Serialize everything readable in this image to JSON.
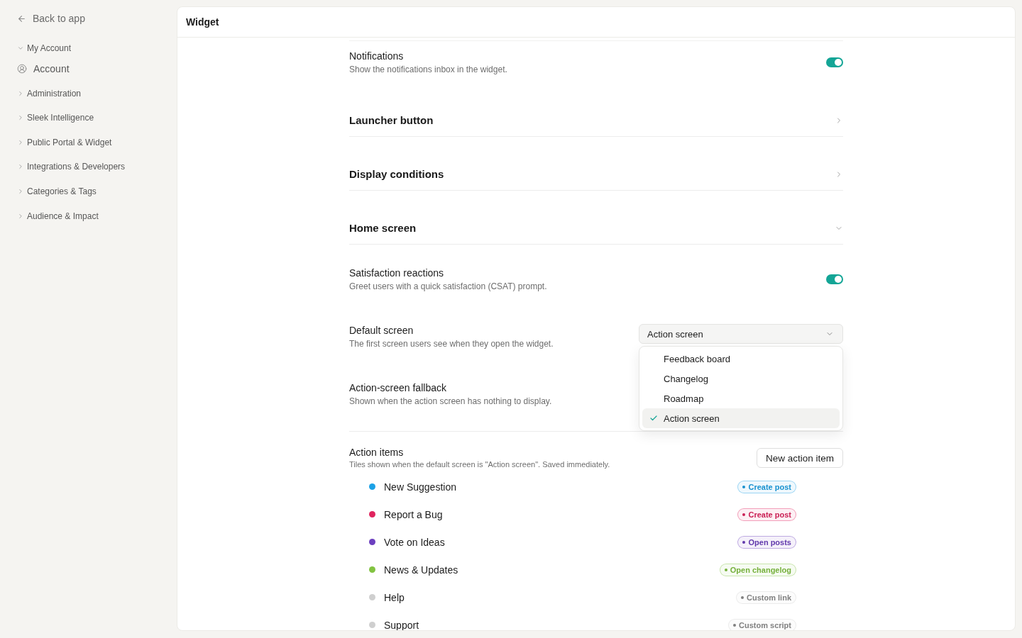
{
  "sidebar": {
    "back_link": "Back to app",
    "groups": [
      {
        "label": "My Account",
        "expanded": true,
        "children": [
          {
            "label": "Account"
          }
        ]
      },
      {
        "label": "Administration",
        "expanded": false
      },
      {
        "label": "Sleek Intelligence",
        "expanded": false
      },
      {
        "label": "Public Portal & Widget",
        "expanded": false
      },
      {
        "label": "Integrations & Developers",
        "expanded": false
      },
      {
        "label": "Categories & Tags",
        "expanded": false
      },
      {
        "label": "Audience & Impact",
        "expanded": false
      }
    ]
  },
  "header": {
    "title": "Widget"
  },
  "settings": [
    {
      "kind": "toggle",
      "title": "Notifications",
      "description": "Show the notifications inbox in the widget.",
      "on": true
    },
    {
      "kind": "section",
      "title": "Launcher button",
      "expanded": false
    },
    {
      "kind": "section",
      "title": "Display conditions",
      "expanded": false
    },
    {
      "kind": "section",
      "title": "Home screen",
      "expanded": true,
      "children": [
        {
          "kind": "toggle",
          "title": "Satisfaction reactions",
          "description": "Greet users with a quick satisfaction (CSAT) prompt.",
          "on": true
        },
        {
          "kind": "select",
          "title": "Default screen",
          "description": "The first screen users see when they open the widget.",
          "value": "Action screen",
          "open": true,
          "options": [
            {
              "label": "Feedback board",
              "selected": false
            },
            {
              "label": "Changelog",
              "selected": false
            },
            {
              "label": "Roadmap",
              "selected": false
            },
            {
              "label": "Action screen",
              "selected": true
            }
          ]
        },
        {
          "kind": "text",
          "title": "Action-screen fallback",
          "description": "Shown when the action screen has nothing to display."
        },
        {
          "kind": "action_list",
          "title": "Action items",
          "description": "Tiles shown when the default screen is \"Action screen\". Saved immediately.",
          "button": "New action item",
          "items": [
            {
              "label": "New Suggestion",
              "color": "#1ba1e6",
              "badge": "Create post"
            },
            {
              "label": "Report a Bug",
              "color": "#e0245e",
              "badge": "Create post"
            },
            {
              "label": "Vote on Ideas",
              "color": "#6c3fbf",
              "badge": "Open posts"
            },
            {
              "label": "News & Updates",
              "color": "#82c341",
              "badge": "Open changelog"
            },
            {
              "label": "Help",
              "color": "#cfcfcf",
              "badge": "Custom link"
            },
            {
              "label": "Support",
              "color": "#cfcfcf",
              "badge": "Custom script"
            }
          ]
        }
      ]
    }
  ]
}
